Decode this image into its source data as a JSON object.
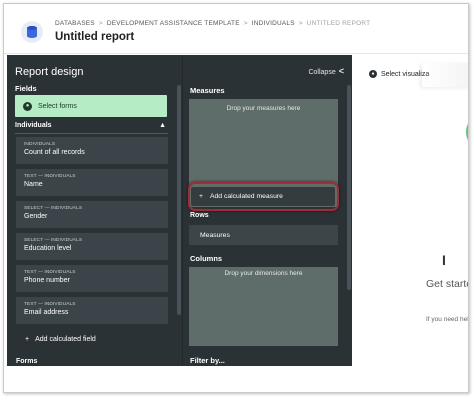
{
  "header": {
    "breadcrumb": [
      "DATABASES",
      "DEVELOPMENT ASSISTANCE TEMPLATE",
      "INDIVIDUALS",
      "UNTITLED REPORT"
    ],
    "title": "Untitled report",
    "icon": "database-icon"
  },
  "report_design": {
    "title": "Report design",
    "fields_label": "Fields",
    "select_forms_label": "Select forms",
    "section_label": "Individuals",
    "fields": [
      {
        "type": "INDIVIDUALS",
        "name": "Count of all records"
      },
      {
        "type": "TEXT — INDIVIDUALS",
        "name": "Name"
      },
      {
        "type": "SELECT — INDIVIDUALS",
        "name": "Gender"
      },
      {
        "type": "SELECT — INDIVIDUALS",
        "name": "Education level"
      },
      {
        "type": "TEXT — INDIVIDUALS",
        "name": "Phone number"
      },
      {
        "type": "TEXT — INDIVIDUALS",
        "name": "Email address"
      }
    ],
    "add_calculated_field": "Add calculated field",
    "forms_label": "Forms"
  },
  "middle": {
    "collapse_label": "Collapse",
    "measures_label": "Measures",
    "drop_measures": "Drop your measures here",
    "add_calculated_measure": "Add calculated measure",
    "rows_label": "Rows",
    "rows_chip": "Measures",
    "columns_label": "Columns",
    "drop_dimensions": "Drop your dimensions here",
    "filter_label": "Filter by..."
  },
  "right": {
    "select_visualization": "Select visualiza",
    "heading_glyph": "I",
    "get_started": "Get starte",
    "need_help": "If you need hel"
  },
  "colors": {
    "panel_bg": "#2b3236",
    "select_forms_bg": "#b5ecc6",
    "drop_zone_bg": "#5e6c6a",
    "highlight": "#a02c35"
  }
}
